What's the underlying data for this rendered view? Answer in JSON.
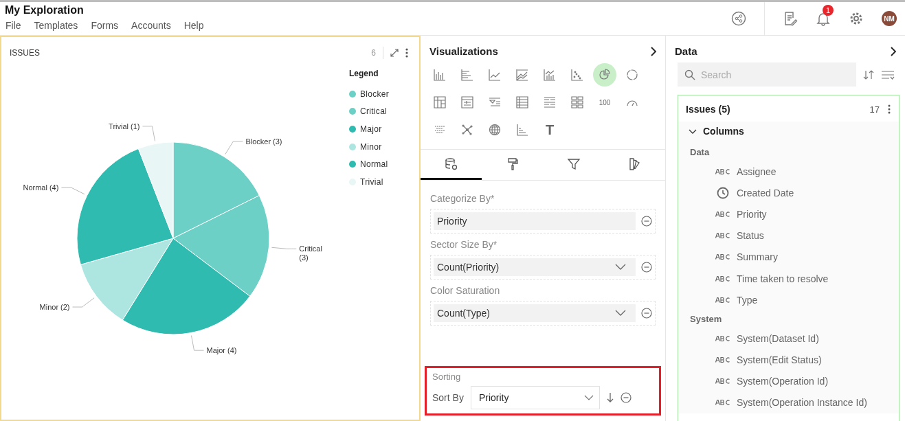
{
  "window": {
    "title": "My Exploration"
  },
  "menu": [
    {
      "label": "File"
    },
    {
      "label": "Templates"
    },
    {
      "label": "Forms"
    },
    {
      "label": "Accounts"
    },
    {
      "label": "Help"
    }
  ],
  "header": {
    "notifications": "1",
    "avatar": "NM"
  },
  "widget": {
    "title": "ISSUES",
    "count": "6",
    "legend_title": "Legend",
    "legend": [
      {
        "label": "Blocker",
        "color": "#6dd0c7"
      },
      {
        "label": "Critical",
        "color": "#6dd0c7"
      },
      {
        "label": "Major",
        "color": "#2fbbaf"
      },
      {
        "label": "Minor",
        "color": "#ade6e1"
      },
      {
        "label": "Normal",
        "color": "#2fbbaf"
      },
      {
        "label": "Trivial",
        "color": "#e8f6f5"
      }
    ],
    "chart_data": {
      "type": "pie",
      "categories": [
        "Blocker",
        "Critical",
        "Major",
        "Minor",
        "Normal",
        "Trivial"
      ],
      "values": [
        3,
        3,
        4,
        2,
        4,
        1
      ],
      "value_labels": [
        "(3)",
        "(3)",
        "(4)",
        "(2)",
        "(4)",
        "(1)"
      ]
    }
  },
  "visualizations": {
    "title": "Visualizations",
    "types": [
      {
        "kind": "bar",
        "selected": false
      },
      {
        "kind": "hbar",
        "selected": false
      },
      {
        "kind": "line",
        "selected": false
      },
      {
        "kind": "area",
        "selected": false
      },
      {
        "kind": "combo",
        "selected": false
      },
      {
        "kind": "scatter",
        "selected": false
      },
      {
        "kind": "pie",
        "selected": true
      },
      {
        "kind": "donut",
        "selected": false
      },
      {
        "kind": "pivot",
        "selected": false
      },
      {
        "kind": "form",
        "selected": false
      },
      {
        "kind": "filter",
        "selected": false
      },
      {
        "kind": "table",
        "selected": false
      },
      {
        "kind": "list",
        "selected": false
      },
      {
        "kind": "tiles",
        "selected": false
      },
      {
        "kind": "number",
        "glyph": "100",
        "selected": false
      },
      {
        "kind": "gauge",
        "selected": false
      },
      {
        "kind": "heat",
        "selected": false
      },
      {
        "kind": "network",
        "selected": false
      },
      {
        "kind": "globe",
        "selected": false
      },
      {
        "kind": "step",
        "selected": false
      },
      {
        "kind": "text",
        "glyph": "T",
        "selected": false
      }
    ],
    "tabs": [
      {
        "kind": "data",
        "selected": true
      },
      {
        "kind": "format",
        "selected": false
      },
      {
        "kind": "filter",
        "selected": false
      },
      {
        "kind": "palette",
        "selected": false
      }
    ],
    "fields": [
      {
        "label": "Categorize By*",
        "value": "Priority",
        "dropdown": false
      },
      {
        "label": "Sector Size By*",
        "value": "Count(Priority)",
        "dropdown": true
      },
      {
        "label": "Color Saturation",
        "value": "Count(Type)",
        "dropdown": true
      }
    ],
    "sorting": {
      "title": "Sorting",
      "label": "Sort By",
      "value": "Priority",
      "highlighted": true
    }
  },
  "data": {
    "title": "Data",
    "search": {
      "placeholder": "Search"
    },
    "dataset": {
      "name": "Issues (5)",
      "count": "17",
      "section": "Columns",
      "expanded": true,
      "groups": [
        {
          "label": "Data",
          "items": [
            {
              "kind": "text",
              "label": "Assignee"
            },
            {
              "kind": "date",
              "label": "Created Date"
            },
            {
              "kind": "text",
              "label": "Priority"
            },
            {
              "kind": "text",
              "label": "Status"
            },
            {
              "kind": "text",
              "label": "Summary"
            },
            {
              "kind": "text",
              "label": "Time taken to resolve"
            },
            {
              "kind": "text",
              "label": "Type"
            }
          ]
        },
        {
          "label": "System",
          "items": [
            {
              "kind": "text",
              "label": "System(Dataset Id)"
            },
            {
              "kind": "text",
              "label": "System(Edit Status)"
            },
            {
              "kind": "text",
              "label": "System(Operation Id)"
            },
            {
              "kind": "text",
              "label": "System(Operation Instance Id)"
            }
          ]
        }
      ]
    }
  }
}
